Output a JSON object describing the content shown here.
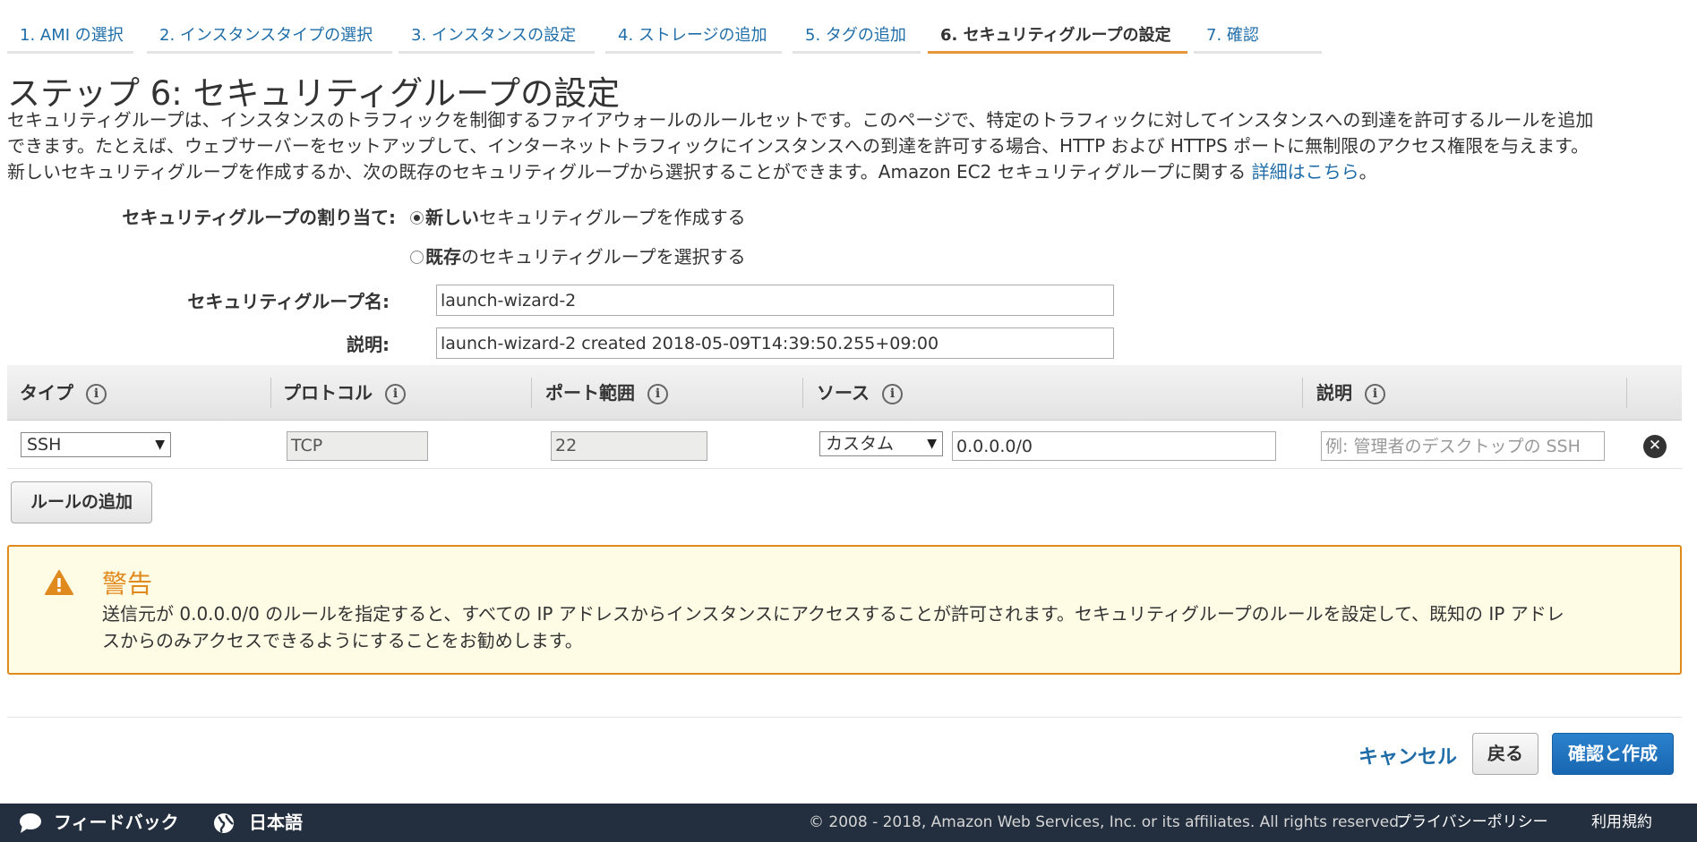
{
  "steps": [
    {
      "label": "1. AMI の選択"
    },
    {
      "label": "2. インスタンスタイプの選択"
    },
    {
      "label": "3. インスタンスの設定"
    },
    {
      "label": "4. ストレージの追加"
    },
    {
      "label": "5. タグの追加"
    },
    {
      "label": "6. セキュリティグループの設定"
    },
    {
      "label": "7. 確認"
    }
  ],
  "active_step": 6,
  "page": {
    "title": "ステップ 6: セキュリティグループの設定",
    "intro_line1": "セキュリティグループは、インスタンスのトラフィックを制御するファイアウォールのルールセットです。このページで、特定のトラフィックに対してインスタンスへの到達を許可するルールを追加",
    "intro_line2": "できます。たとえば、ウェブサーバーをセットアップして、インターネットトラフィックにインスタンスへの到達を許可する場合、HTTP および HTTPS ポートに無制限のアクセス権限を与えます。",
    "intro_line3": "新しいセキュリティグループを作成するか、次の既存のセキュリティグループから選択することができます。Amazon EC2 セキュリティグループに関する ",
    "intro_link": "詳細はこちら",
    "intro_end": "。"
  },
  "form": {
    "assign_label": "セキュリティグループの割り当て:",
    "option_new_bold": "新しい",
    "option_new_rest": "セキュリティグループを作成する",
    "option_existing_bold": "既存",
    "option_existing_rest": "のセキュリティグループを選択する",
    "selected_option": "new",
    "name_label": "セキュリティグループ名:",
    "name_value": "launch-wizard-2",
    "desc_label": "説明:",
    "desc_value": "launch-wizard-2 created 2018-05-09T14:39:50.255+09:00"
  },
  "rules": {
    "headers": [
      "タイプ",
      "プロトコル",
      "ポート範囲",
      "ソース",
      "説明"
    ],
    "info_glyph": "i",
    "rows": [
      {
        "type": "SSH",
        "protocol": "TCP",
        "port": "22",
        "source_mode": "カスタム",
        "source_cidr": "0.0.0.0/0",
        "description_placeholder": "例: 管理者のデスクトップの SSH"
      }
    ],
    "remove_glyph": "✕",
    "add_rule_label": "ルールの追加"
  },
  "warning": {
    "title": "警告",
    "text_line1": "送信元が 0.0.0.0/0 のルールを指定すると、すべての IP アドレスからインスタンスにアクセスすることが許可されます。セキュリティグループのルールを設定して、既知の IP アドレ",
    "text_line2": "スからのみアクセスできるようにすることをお勧めします。",
    "color": "#e08a1e"
  },
  "actions": {
    "cancel": "キャンセル",
    "back": "戻る",
    "confirm": "確認と作成"
  },
  "footer": {
    "feedback": "フィードバック",
    "language": "日本語",
    "copyright": "© 2008 - 2018, Amazon Web Services, Inc. or its affiliates. All rights reserved.",
    "privacy": "プライバシーポリシー",
    "terms": "利用規約"
  },
  "colors": {
    "link": "#1f6da8",
    "active_tab_underline": "#e7963b",
    "primary_button": "#1866b2",
    "footer_bg": "#232f3e"
  },
  "icons": {
    "warning": "warning-triangle-icon",
    "remove": "remove-circle-icon",
    "feedback": "speech-bubble-icon",
    "language": "globe-icon",
    "dropdown": "caret-down-icon",
    "info": "info-circle-icon"
  }
}
